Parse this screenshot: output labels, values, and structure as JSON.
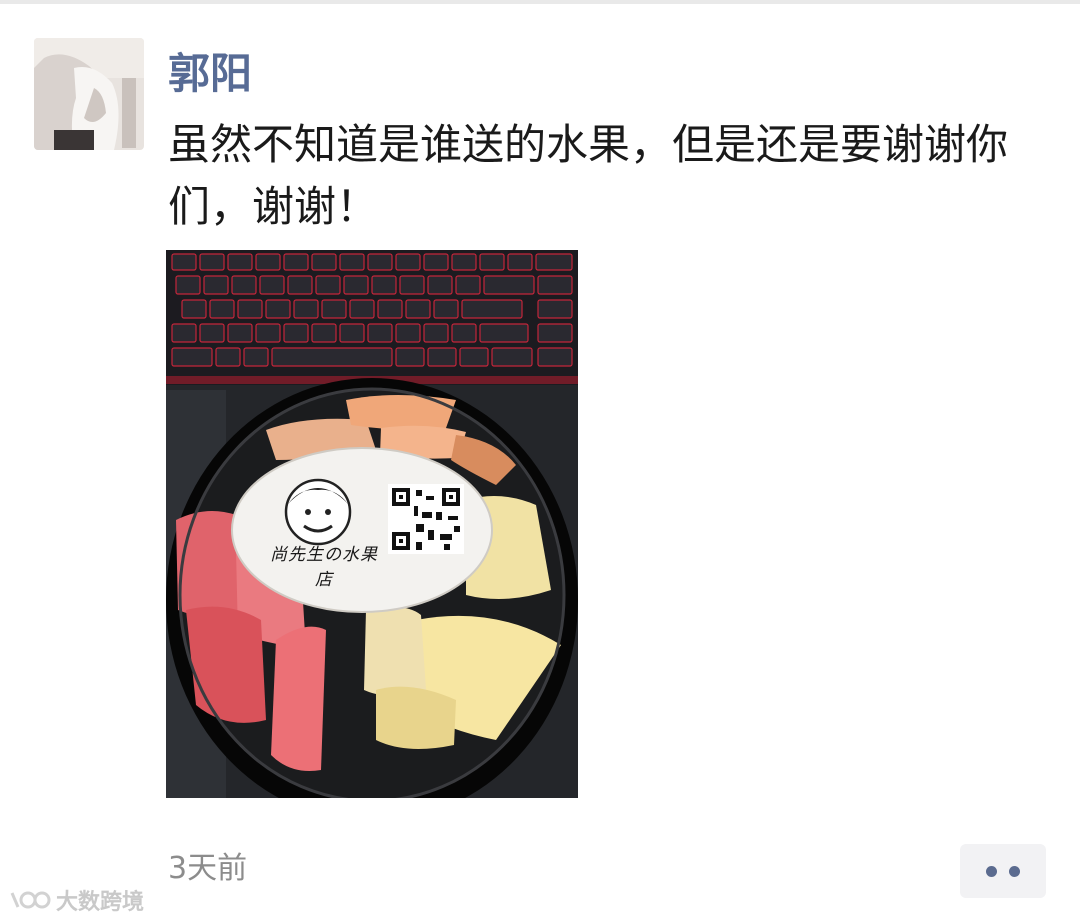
{
  "post": {
    "author": "郭阳",
    "text": "虽然不知道是谁送的水果，但是还是要谢谢你们，谢谢！",
    "time": "3天前"
  },
  "photo": {
    "subject": "fruit-container-on-keyboard",
    "sticker_brand": "尚先生の水果店"
  },
  "watermark": {
    "text": "大数跨境"
  },
  "colors": {
    "author_name": "#576b95",
    "text": "#1a1a1a",
    "timestamp": "#8c8c8c",
    "more_dots": "#5b6b8f"
  }
}
